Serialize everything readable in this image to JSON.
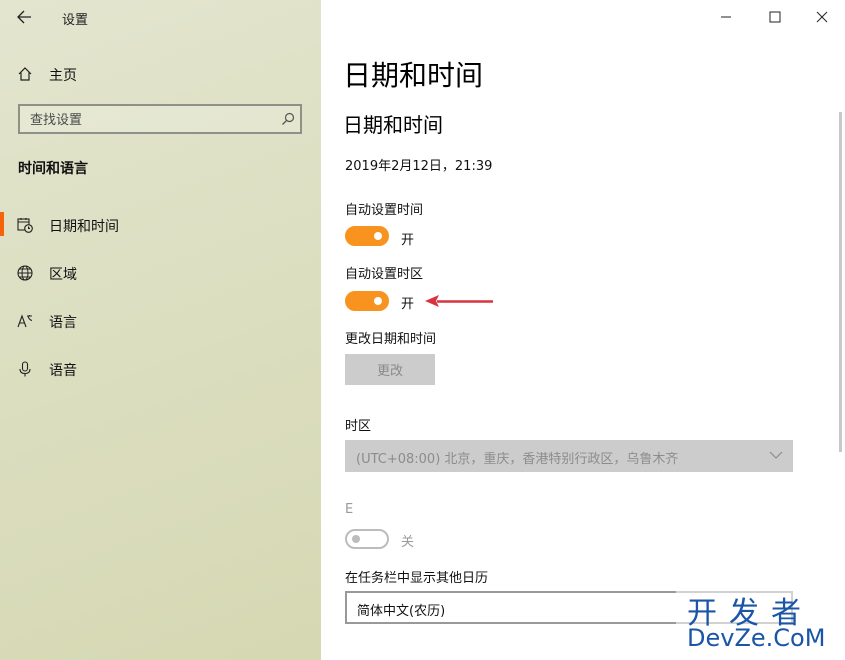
{
  "window": {
    "title": "设置"
  },
  "sidebar": {
    "home_label": "主页",
    "search_placeholder": "查找设置",
    "section_title": "时间和语言",
    "items": [
      {
        "label": "日期和时间",
        "icon": "calendar-clock-icon",
        "active": true
      },
      {
        "label": "区域",
        "icon": "globe-icon"
      },
      {
        "label": "语言",
        "icon": "language-icon"
      },
      {
        "label": "语音",
        "icon": "microphone-icon"
      }
    ]
  },
  "main": {
    "page_title": "日期和时间",
    "section_title": "日期和时间",
    "current_datetime": "2019年2月12日，21:39",
    "auto_time": {
      "label": "自动设置时间",
      "state": "开"
    },
    "auto_timezone": {
      "label": "自动设置时区",
      "state": "开"
    },
    "change_datetime": {
      "label": "更改日期和时间",
      "button": "更改"
    },
    "timezone": {
      "label": "时区",
      "value": "(UTC+08:00) 北京，重庆，香港特别行政区，乌鲁木齐"
    },
    "dst": {
      "label": "E",
      "state": "关"
    },
    "taskbar_calendar": {
      "label": "在任务栏中显示其他日历",
      "value": "简体中文(农历)"
    }
  },
  "watermark": {
    "cn": "开发者",
    "en": "DevZe.CoM"
  },
  "colors": {
    "accent": "#f7931e",
    "annotation": "#d9333f",
    "watermark": "#1a55a8"
  }
}
